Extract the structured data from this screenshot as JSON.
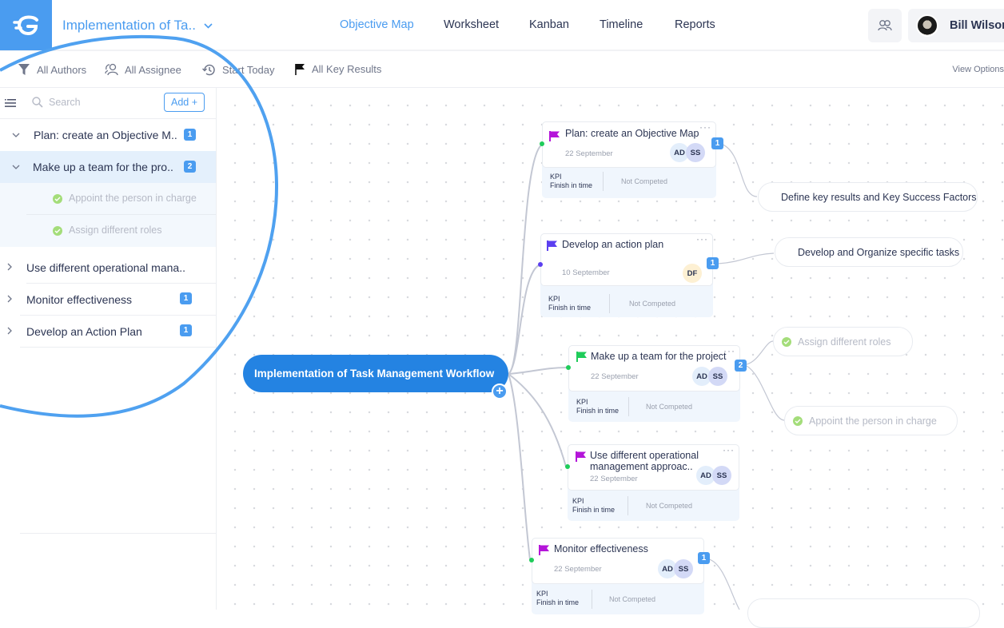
{
  "header": {
    "logo_icon": "goalscape-logo-icon",
    "project_title": "Implementation of Ta..",
    "nav": [
      {
        "label": "Objective Map",
        "active": true
      },
      {
        "label": "Worksheet",
        "active": false
      },
      {
        "label": "Kanban",
        "active": false
      },
      {
        "label": "Timeline",
        "active": false
      },
      {
        "label": "Reports",
        "active": false
      }
    ],
    "team_icon": "team-icon",
    "user_name": "Bill Wilson"
  },
  "filters": {
    "authors": "All Authors",
    "assignee": "All Assignee",
    "start": "Start Today",
    "key_results": "All Key Results",
    "view_options": "View Options"
  },
  "sidebar": {
    "search_placeholder": "Search",
    "add_label": "Add +",
    "items": [
      {
        "label": "Plan: create an Objective M..",
        "count": "1",
        "expanded": true
      },
      {
        "label": "Make up a team for the pro..",
        "count": "2",
        "expanded": true,
        "selected": true,
        "children": [
          "Appoint the person in charge",
          "Assign different roles"
        ]
      },
      {
        "label": "Use different operational mana..",
        "count": "",
        "expanded": false
      },
      {
        "label": "Monitor effectiveness",
        "count": "1",
        "expanded": false
      },
      {
        "label": "Develop an Action Plan",
        "count": "1",
        "expanded": false
      }
    ]
  },
  "map": {
    "root": "Implementation of Task Management Workflow",
    "colors": {
      "accent": "#4a9cf0",
      "root": "#2483e2",
      "flag_magenta": "#b415d9",
      "flag_indigo": "#5b3ff0",
      "flag_green": "#1fcc5a"
    },
    "cards": [
      {
        "title": "Plan: create an Objective Map",
        "title2": "",
        "date": "22 September",
        "avatars": [
          "AD",
          "SS"
        ],
        "kpi_label": "KPI",
        "kpi_value": "Finish in time",
        "status": "Not Competed",
        "count": "1",
        "flag": "magenta"
      },
      {
        "title": "Develop an action plan",
        "title2": "",
        "date": "10 September",
        "avatars": [
          "DF"
        ],
        "kpi_label": "KPI",
        "kpi_value": "Finish in time",
        "status": "Not Competed",
        "count": "1",
        "flag": "indigo"
      },
      {
        "title": "Make up a team for the project",
        "title2": "",
        "date": "22 September",
        "avatars": [
          "AD",
          "SS"
        ],
        "kpi_label": "KPI",
        "kpi_value": "Finish in time",
        "status": "Not Competed",
        "count": "2",
        "flag": "green"
      },
      {
        "title": "Use different operational",
        "title2": "management approac..",
        "date": "22 September",
        "avatars": [
          "AD",
          "SS"
        ],
        "kpi_label": "KPI",
        "kpi_value": "Finish in time",
        "status": "Not Competed",
        "count": "",
        "flag": "magenta"
      },
      {
        "title": "Monitor effectiveness",
        "title2": "",
        "date": "22 September",
        "avatars": [
          "AD",
          "SS"
        ],
        "kpi_label": "KPI",
        "kpi_value": "Finish in time",
        "status": "Not Competed",
        "count": "1",
        "flag": "magenta"
      }
    ],
    "key_results": [
      {
        "label": "Define key results and Key Success Factors",
        "done": false
      },
      {
        "label": "Develop and Organize specific tasks",
        "done": false
      },
      {
        "label": "Assign different roles",
        "done": true
      },
      {
        "label": "Appoint the person in charge",
        "done": true
      }
    ]
  }
}
